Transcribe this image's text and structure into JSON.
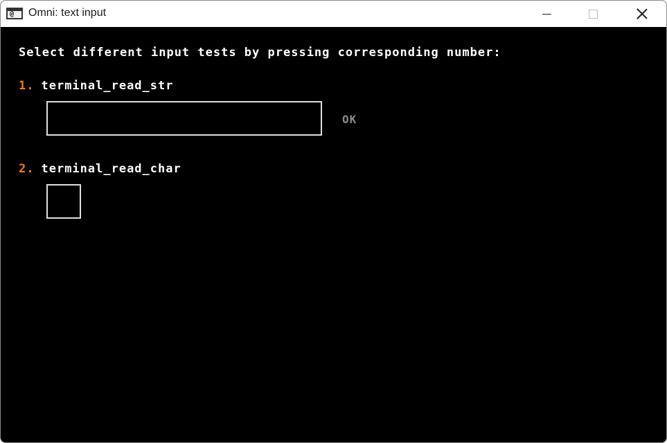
{
  "window": {
    "title": "Omni: text input",
    "icon": "console-icon",
    "icon_glyph": "@"
  },
  "content": {
    "prompt": "Select different input tests by pressing corresponding number:",
    "tests": [
      {
        "number": "1.",
        "label": "terminal_read_str",
        "field_value": "",
        "button_label": "OK"
      },
      {
        "number": "2.",
        "label": "terminal_read_char",
        "field_value": ""
      }
    ]
  },
  "colors": {
    "background": "#000000",
    "text": "#ffffff",
    "accent_number": "#f07d1a",
    "disabled_button": "#8a8a8a",
    "field_border": "#e0e0e0"
  }
}
